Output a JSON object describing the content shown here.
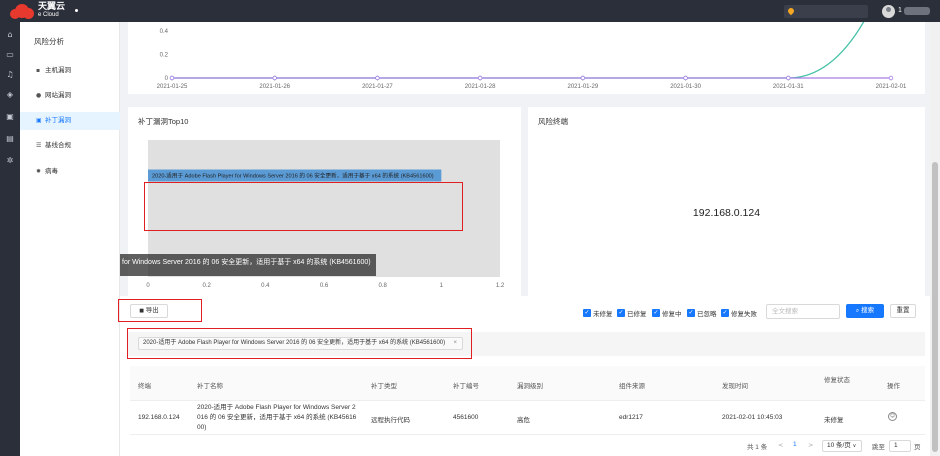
{
  "topbar": {
    "brand_cn": "天翼云",
    "brand_en": "e Cloud",
    "user_initial": "1"
  },
  "sidebar": {
    "section_title": "风险分析",
    "items": [
      {
        "label": "主机漏洞",
        "icon": "list-icon"
      },
      {
        "label": "网站漏洞",
        "icon": "globe-icon"
      },
      {
        "label": "补丁漏洞",
        "icon": "patch-icon",
        "active": true
      },
      {
        "label": "基线合规",
        "icon": "checklist-icon"
      },
      {
        "label": "病毒",
        "icon": "virus-icon"
      }
    ]
  },
  "trend_chart": {
    "type": "line",
    "x": [
      "2021-01-25",
      "2021-01-26",
      "2021-01-27",
      "2021-01-28",
      "2021-01-29",
      "2021-01-30",
      "2021-01-31",
      "2021-02-01"
    ],
    "y_ticks": [
      "0.4",
      "0.2",
      "0"
    ],
    "series": [
      {
        "values": [
          0,
          0,
          0,
          0,
          0,
          0,
          0,
          1
        ],
        "color": "#46c2a8"
      },
      {
        "values": [
          0,
          0,
          0,
          0,
          0,
          0,
          0,
          0
        ],
        "color": "#a77ee6"
      }
    ]
  },
  "patch_top10": {
    "title": "补丁漏洞Top10",
    "chart_data": {
      "type": "bar",
      "orientation": "horizontal",
      "categories": [
        "2020-适用于 Adobe Flash Player for Windows Server 2016 的 06 安全更新，适用于基于 x64 的系统 (KB4561600)"
      ],
      "values": [
        1
      ],
      "x_ticks": [
        "0",
        "0.2",
        "0.4",
        "0.6",
        "0.8",
        "1",
        "1.2"
      ],
      "xlim": [
        0,
        1.2
      ],
      "bar_color": "#5b9bd5",
      "plot_bg": "#e0e0e0"
    },
    "tooltip": "for Windows Server 2016 的 06 安全更新，适用于基于 x64 的系统 (KB4561600)"
  },
  "risk_terminal": {
    "title": "风险终端",
    "ip": "192.168.0.124"
  },
  "toolbar": {
    "export_label": "导出",
    "filters": [
      {
        "label": "未修复",
        "checked": true
      },
      {
        "label": "已修复",
        "checked": true
      },
      {
        "label": "修复中",
        "checked": true
      },
      {
        "label": "已忽略",
        "checked": true
      },
      {
        "label": "修复失败",
        "checked": true
      }
    ],
    "search_placeholder": "全文搜索",
    "search_button": "搜索",
    "reset_button": "重置"
  },
  "filter_tag": {
    "text": "2020-适用于 Adobe Flash Player for Windows Server 2016 的 06 安全更新，适用于基于 x64 的系统 (KB4561600)",
    "close": "×"
  },
  "table": {
    "headers": [
      "终端",
      "补丁名称",
      "补丁类型",
      "补丁编号",
      "漏洞级别",
      "组件来源",
      "发现时间",
      "修复状态",
      "操作"
    ],
    "rows": [
      {
        "terminal": "192.168.0.124",
        "name_lines": [
          "2020-适用于 Adobe Flash Player for Windows Server 2",
          "016 的 06 安全更新，适用于基于 x64 的系统 (KB45616",
          "00)"
        ],
        "type": "远程执行代码",
        "number": "4561600",
        "level": "高危",
        "source": "edr1217",
        "found": "2021-02-01 10:45:03",
        "status": "未修复"
      }
    ]
  },
  "pagination": {
    "total": "共 1 条",
    "prev": "<",
    "current": "1",
    "next": ">",
    "page_size": "10 条/页",
    "goto_label": "跳至",
    "goto_value": "1",
    "page_suffix": "页"
  }
}
